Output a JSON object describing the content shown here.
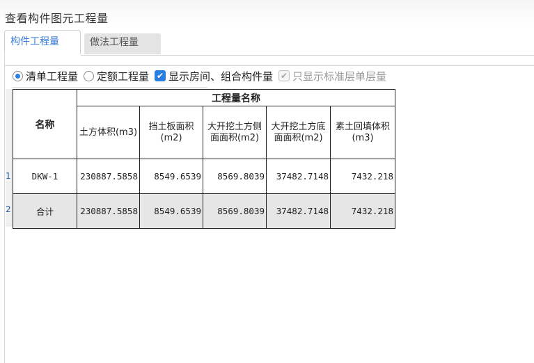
{
  "window": {
    "title": "查看构件图元工程量"
  },
  "tabs": [
    {
      "label": "构件工程量",
      "active": true
    },
    {
      "label": "做法工程量",
      "active": false
    }
  ],
  "options": {
    "radio_bill": {
      "label": "清单工程量",
      "checked": true
    },
    "radio_quota": {
      "label": "定额工程量",
      "checked": false
    },
    "check_room": {
      "label": "显示房间、组合构件量",
      "checked": true
    },
    "check_standard_floor": {
      "label": "只显示标准层单层量",
      "checked": true,
      "disabled": true
    }
  },
  "colors": {
    "accent": "#2a7de1",
    "tab_active_text": "#3a7bd5",
    "total_row_bg": "#e6e6e6"
  },
  "table": {
    "name_header": "名称",
    "group_header": "工程量名称",
    "columns": [
      "土方体积(m3)",
      "挡土板面积(m2)",
      "大开挖土方侧面面积(m2)",
      "大开挖土方底面面积(m2)",
      "素土回填体积(m3)"
    ],
    "rows": [
      {
        "index": "1",
        "name": "DKW-1",
        "values": [
          "230887.5858",
          "8549.6539",
          "8569.8039",
          "37482.7148",
          "7432.218"
        ]
      },
      {
        "index": "2",
        "name": "合计",
        "values": [
          "230887.5858",
          "8549.6539",
          "8569.8039",
          "37482.7148",
          "7432.218"
        ]
      }
    ]
  }
}
